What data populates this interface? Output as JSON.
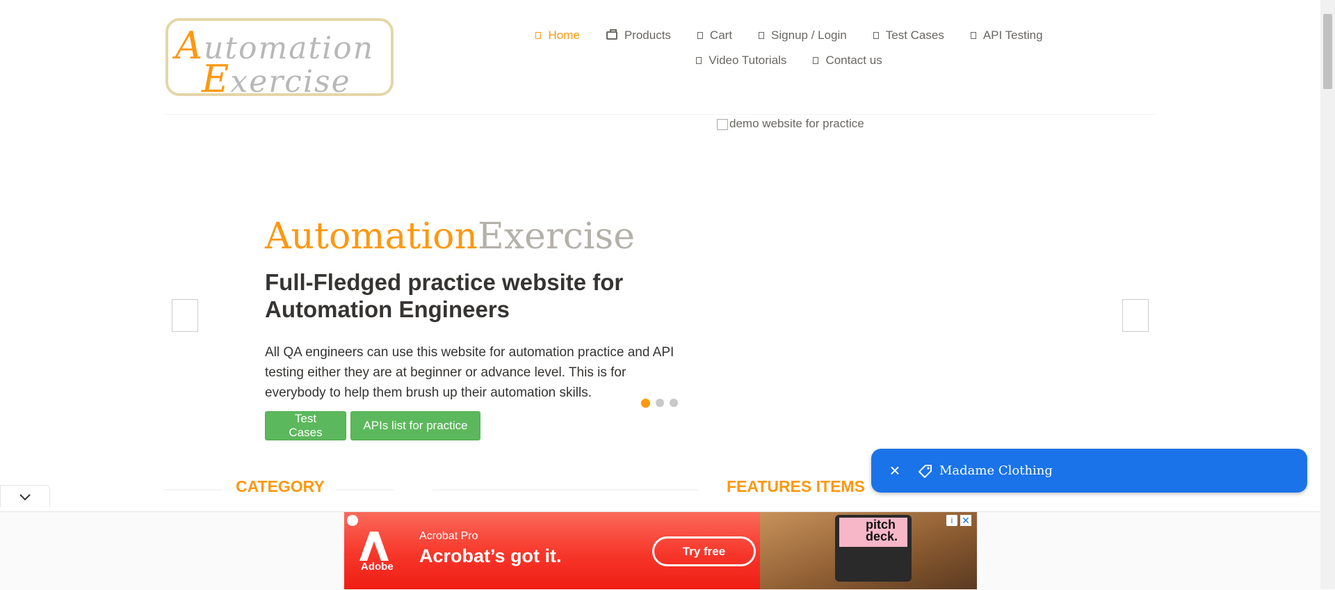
{
  "logo": {
    "first_cap": "A",
    "first_rest": "utomation",
    "second_cap": "E",
    "second_rest": "xercise"
  },
  "nav": {
    "row1": [
      {
        "label": "Home",
        "icon": "home-icon",
        "active": true
      },
      {
        "label": "Products",
        "icon": "briefcase-icon"
      },
      {
        "label": "Cart",
        "icon": "cart-icon"
      },
      {
        "label": "Signup / Login",
        "icon": "lock-icon"
      },
      {
        "label": "Test Cases",
        "icon": "list-icon"
      },
      {
        "label": "API Testing",
        "icon": "list-icon"
      }
    ],
    "row2": [
      {
        "label": "Video Tutorials",
        "icon": "youtube-icon"
      },
      {
        "label": "Contact us",
        "icon": "envelope-icon"
      }
    ]
  },
  "slider": {
    "brand_a": "Automation",
    "brand_e": "Exercise",
    "headline": "Full-Fledged practice website for Automation Engineers",
    "description": "All QA engineers can use this website for automation practice and API testing either they are at beginner or advance level. This is for everybody to help them brush up their automation skills.",
    "test_cases_btn": "Test Cases",
    "apis_btn": "APIs list for practice",
    "image_alt": "demo website for practice",
    "active_slide": 1,
    "slide_count": 3
  },
  "sections": {
    "category": "CATEGORY",
    "features": "FEATURES ITEMS"
  },
  "toast": {
    "label": "Madame Clothing",
    "close": "×"
  },
  "ad": {
    "brand": "Adobe",
    "product": "Acrobat Pro",
    "headline": "Acrobat’s got it.",
    "cta": "Try free",
    "screen_text": "pitch deck."
  },
  "colors": {
    "accent": "#fe980f",
    "button_green": "#5cb85c",
    "toast_blue": "#1a73e8",
    "ad_red": "#fa0f00"
  }
}
